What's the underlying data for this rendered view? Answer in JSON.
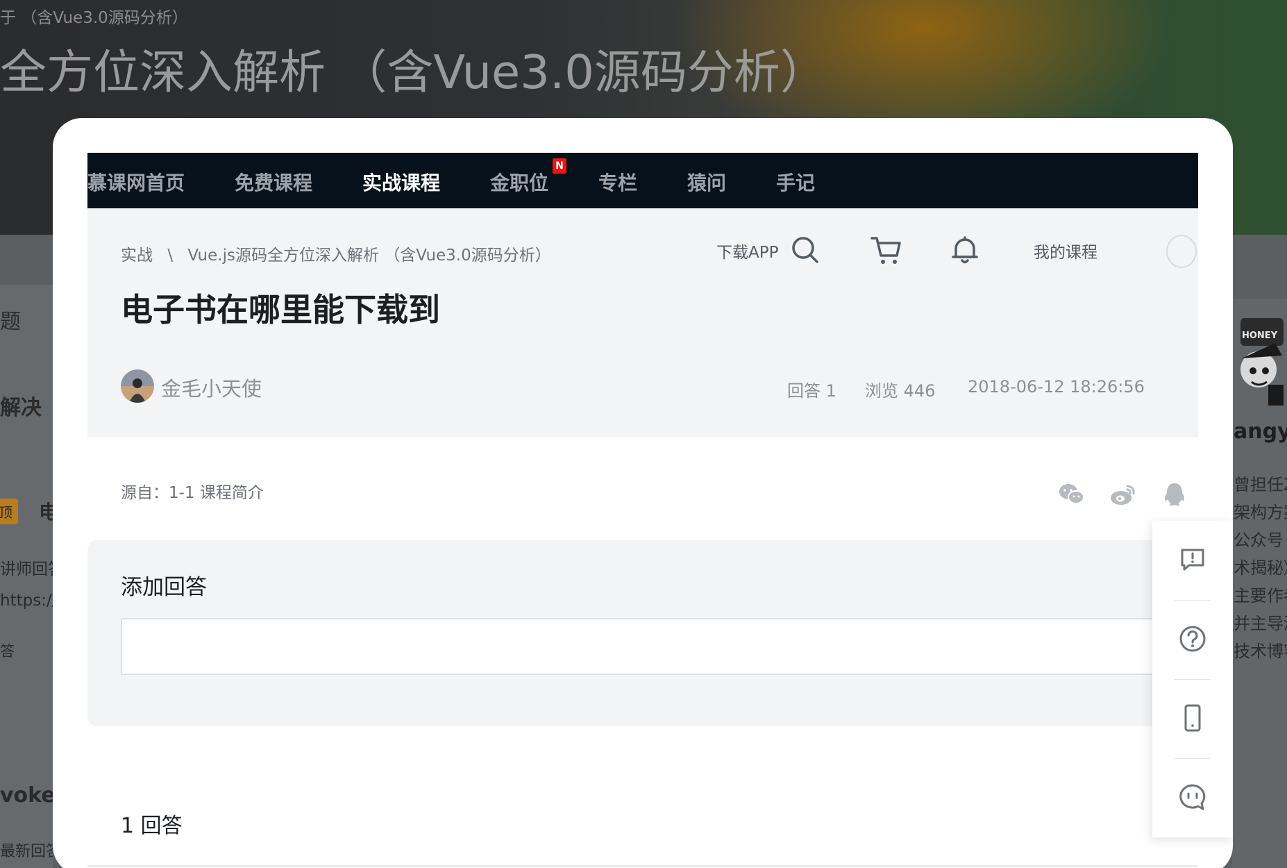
{
  "background": {
    "breadcrumb_fragment": "于  （含Vue3.0源码分析）",
    "title_fragment": "全方位深入解析  （含Vue3.0源码分析）",
    "left_fragments": [
      "题",
      "解决",
      "顶",
      "电",
      "讲师回答",
      "https://",
      "答",
      "vokeln",
      "最新回答"
    ],
    "right_fragments": [
      "HONEY",
      "angyi",
      "曾担任Zo",
      "架构方案",
      "公众号《",
      "术揭秘》",
      "主要作者",
      "并主导滴",
      "技术博客。"
    ]
  },
  "topnav": {
    "items": [
      {
        "label": "慕课网首页",
        "active": false
      },
      {
        "label": "免费课程",
        "active": false
      },
      {
        "label": "实战课程",
        "active": true
      },
      {
        "label": "金职位",
        "active": false
      },
      {
        "label": "专栏",
        "active": false
      },
      {
        "label": "猿问",
        "active": false
      },
      {
        "label": "手记",
        "active": false
      }
    ],
    "badge": "N"
  },
  "toolbar": {
    "download_app": "下载APP",
    "my_courses": "我的课程"
  },
  "breadcrumb": {
    "root": "实战",
    "separator": "\\",
    "course": "Vue.js源码全方位深入解析  （含Vue3.0源码分析）"
  },
  "question": {
    "title": "电子书在哪里能下载到",
    "author": "金毛小天使",
    "answers_label": "回答 1",
    "views_label": "浏览 446",
    "timestamp": "2018-06-12 18:26:56",
    "source": "源自：1-1 课程简介"
  },
  "answer_form": {
    "title": "添加回答",
    "value": ""
  },
  "answers_section": {
    "count_label": "1  回答"
  },
  "icons": {
    "share": [
      "wechat-icon",
      "weibo-icon",
      "qq-icon"
    ],
    "side": [
      "feedback-icon",
      "help-icon",
      "mobile-icon",
      "chat-icon"
    ]
  },
  "colors": {
    "nav_bg": "#07111b",
    "header_bg": "#f3f4f6",
    "badge": "#f01414",
    "text_primary": "#1c1f21",
    "text_secondary": "#8c9095"
  }
}
